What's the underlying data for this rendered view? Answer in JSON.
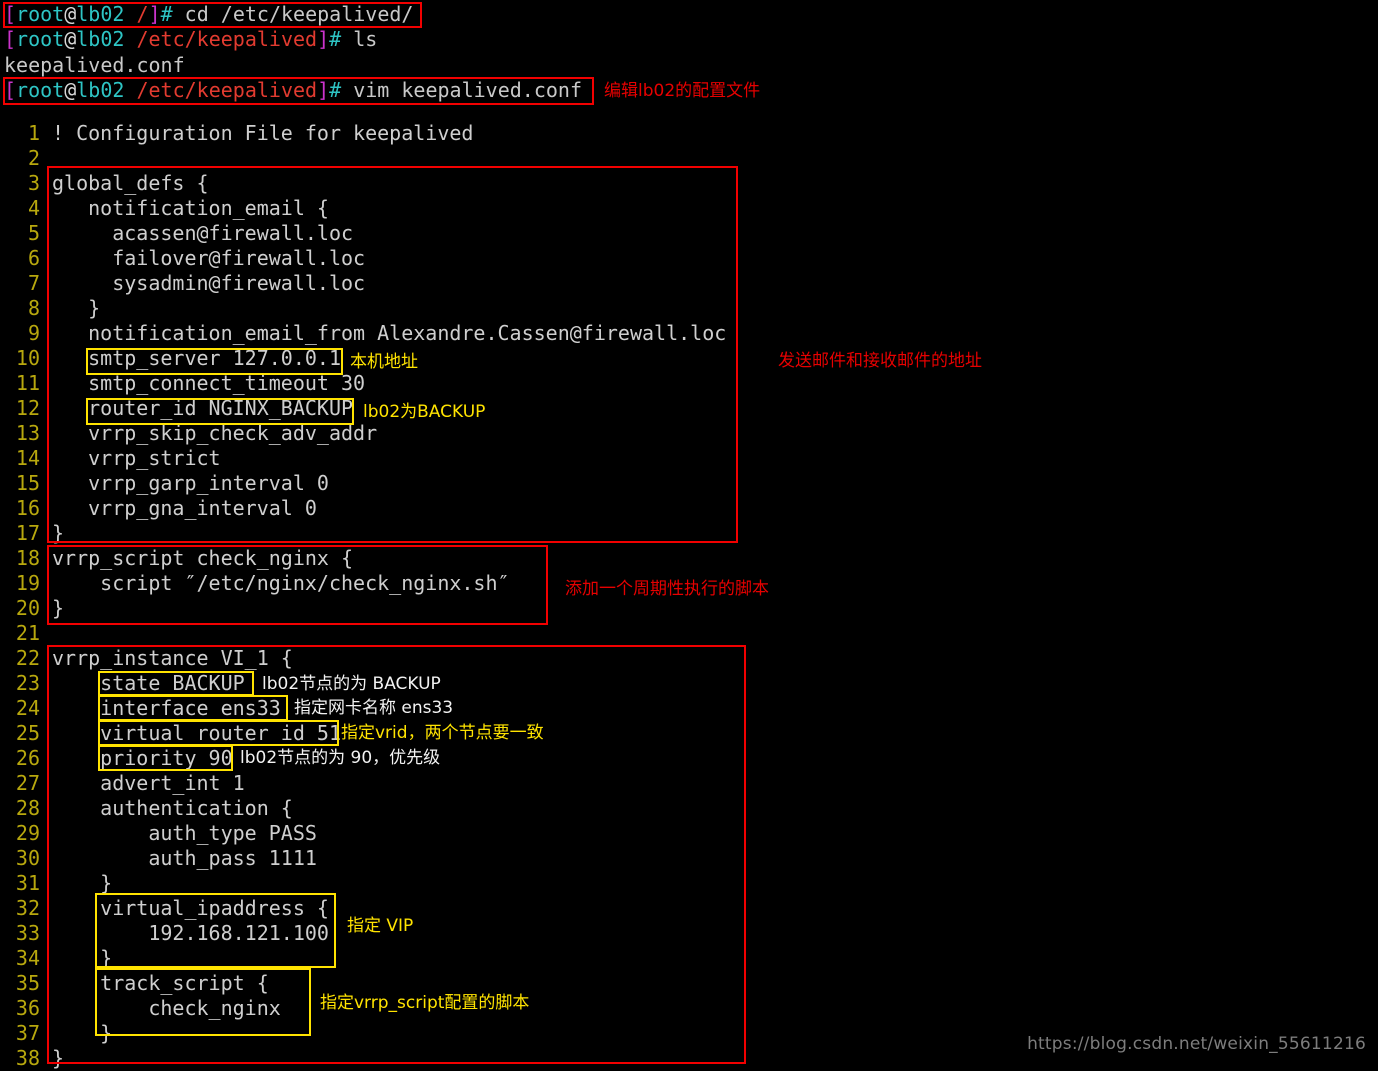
{
  "terminal": {
    "lines": [
      {
        "type": "prompt",
        "bracket_open": "[",
        "user": "root",
        "at": "@",
        "host": "lb02",
        "path": " /",
        "bracket_close": "]",
        "hash": "#",
        "command": " cd /etc/keepalived/"
      },
      {
        "type": "prompt",
        "bracket_open": "[",
        "user": "root",
        "at": "@",
        "host": "lb02",
        "path": " /etc/keepalived",
        "bracket_close": "]",
        "hash": "#",
        "command": " ls"
      },
      {
        "type": "output",
        "text": "keepalived.conf"
      },
      {
        "type": "prompt",
        "bracket_open": "[",
        "user": "root",
        "at": "@",
        "host": "lb02",
        "path": " /etc/keepalived",
        "bracket_close": "]",
        "hash": "#",
        "command": " vim keepalived.conf"
      }
    ]
  },
  "editor": {
    "filename": "keepalived.conf",
    "lines": [
      {
        "n": "1",
        "text": "! Configuration File for keepalived"
      },
      {
        "n": "2",
        "text": ""
      },
      {
        "n": "3",
        "text": "global_defs {"
      },
      {
        "n": "4",
        "text": "   notification_email {"
      },
      {
        "n": "5",
        "text": "     acassen@firewall.loc"
      },
      {
        "n": "6",
        "text": "     failover@firewall.loc"
      },
      {
        "n": "7",
        "text": "     sysadmin@firewall.loc"
      },
      {
        "n": "8",
        "text": "   }"
      },
      {
        "n": "9",
        "text": "   notification_email_from Alexandre.Cassen@firewall.loc"
      },
      {
        "n": "10",
        "text": "   smtp_server 127.0.0.1"
      },
      {
        "n": "11",
        "text": "   smtp_connect_timeout 30"
      },
      {
        "n": "12",
        "text": "   router_id NGINX_BACKUP"
      },
      {
        "n": "13",
        "text": "   vrrp_skip_check_adv_addr"
      },
      {
        "n": "14",
        "text": "   vrrp_strict"
      },
      {
        "n": "15",
        "text": "   vrrp_garp_interval 0"
      },
      {
        "n": "16",
        "text": "   vrrp_gna_interval 0"
      },
      {
        "n": "17",
        "text": "}"
      },
      {
        "n": "18",
        "text": "vrrp_script check_nginx {"
      },
      {
        "n": "19",
        "text": "    script ″/etc/nginx/check_nginx.sh″"
      },
      {
        "n": "20",
        "text": "}"
      },
      {
        "n": "21",
        "text": ""
      },
      {
        "n": "22",
        "text": "vrrp_instance VI_1 {"
      },
      {
        "n": "23",
        "text": "    state BACKUP"
      },
      {
        "n": "24",
        "text": "    interface ens33"
      },
      {
        "n": "25",
        "text": "    virtual_router_id 51"
      },
      {
        "n": "26",
        "text": "    priority 90"
      },
      {
        "n": "27",
        "text": "    advert_int 1"
      },
      {
        "n": "28",
        "text": "    authentication {"
      },
      {
        "n": "29",
        "text": "        auth_type PASS"
      },
      {
        "n": "30",
        "text": "        auth_pass 1111"
      },
      {
        "n": "31",
        "text": "    }"
      },
      {
        "n": "32",
        "text": "    virtual_ipaddress {"
      },
      {
        "n": "33",
        "text": "        192.168.121.100"
      },
      {
        "n": "34",
        "text": "    }"
      },
      {
        "n": "35",
        "text": "    track_script {"
      },
      {
        "n": "36",
        "text": "        check_nginx"
      },
      {
        "n": "37",
        "text": "    }"
      },
      {
        "n": "38",
        "text": "}"
      }
    ]
  },
  "annotations": {
    "edit_config_file": "编辑lb02的配置文件",
    "local_address": "本机地址",
    "lb02_is_backup": "lb02为BACKUP",
    "mail_addresses": "发送邮件和接收邮件的地址",
    "periodic_script": "添加一个周期性执行的脚本",
    "state_backup": "lb02节点的为 BACKUP",
    "interface_name": "指定网卡名称 ens33",
    "vrid_same": "指定vrid，两个节点要一致",
    "priority_90": "lb02节点的为 90，优先级",
    "specify_vip": "指定 VIP",
    "track_script_note": "指定vrrp_script配置的脚本"
  },
  "watermark": {
    "url": "https://blog.csdn.net/weixin_55611216"
  },
  "colors": {
    "background": "#000000",
    "terminal_text": "#c9c9c9",
    "prompt_user": "#2ec5c5",
    "prompt_path": "#e23b30",
    "prompt_bracket": "#cc33cc",
    "line_number": "#b8a80e",
    "code_text": "#cfcfcf",
    "highlight_red": "#f20000",
    "highlight_yellow": "#ffe300",
    "watermark": "#7d7d7d"
  }
}
